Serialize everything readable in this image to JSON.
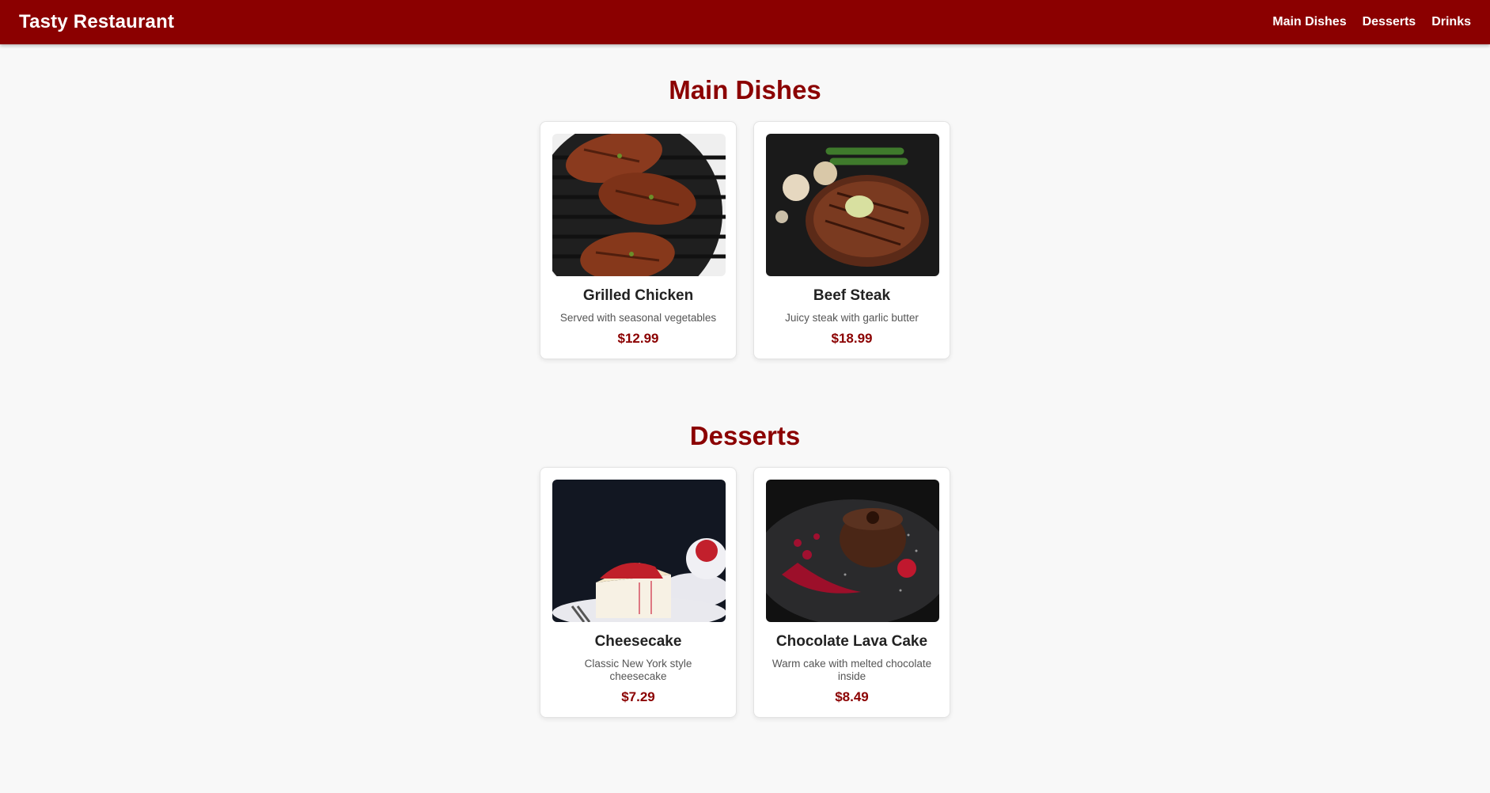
{
  "header": {
    "brand": "Tasty Restaurant",
    "nav": [
      "Main Dishes",
      "Desserts",
      "Drinks"
    ]
  },
  "sections": [
    {
      "title": "Main Dishes",
      "items": [
        {
          "name": "Grilled Chicken",
          "description": "Served with seasonal vegetables",
          "price": "$12.99"
        },
        {
          "name": "Beef Steak",
          "description": "Juicy steak with garlic butter",
          "price": "$18.99"
        }
      ]
    },
    {
      "title": "Desserts",
      "items": [
        {
          "name": "Cheesecake",
          "description": "Classic New York style cheesecake",
          "price": "$7.29"
        },
        {
          "name": "Chocolate Lava Cake",
          "description": "Warm cake with melted chocolate inside",
          "price": "$8.49"
        }
      ]
    }
  ],
  "colors": {
    "brand": "#8b0000",
    "background": "#f8f8f8",
    "card": "#ffffff"
  }
}
